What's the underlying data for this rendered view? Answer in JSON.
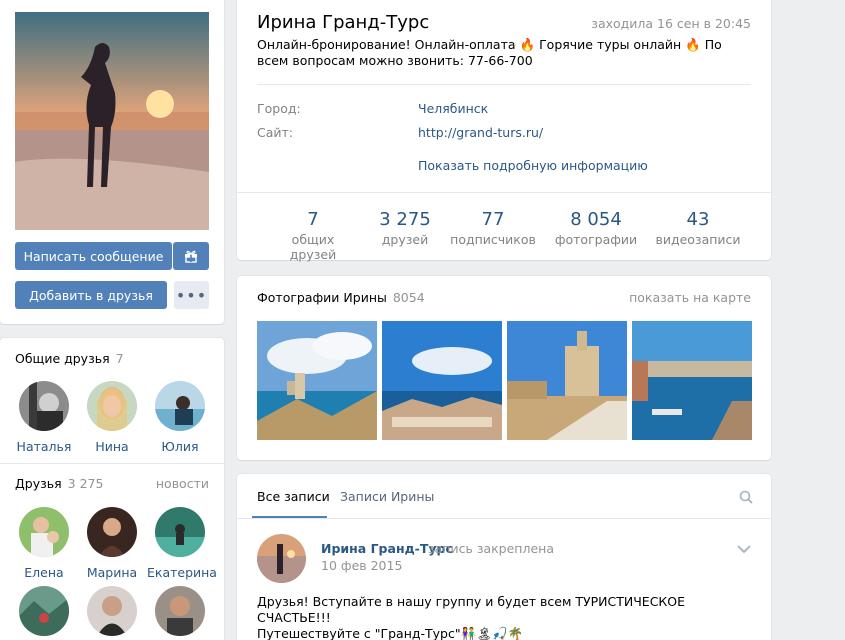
{
  "profile": {
    "name": "Ирина Гранд-Турс",
    "last_seen": "заходила 16 сен в 20:45",
    "status_parts": [
      "Онлайн-бронирование! Онлайн-оплата",
      "Горячие туры онлайн",
      "По всем вопросам можно звонить: 77-66-700"
    ],
    "fire_icon": "🔥"
  },
  "info": {
    "city_label": "Город:",
    "city_value": "Челябинск",
    "site_label": "Сайт:",
    "site_value": "http://grand-turs.ru/",
    "more_link": "Показать подробную информацию"
  },
  "counters": [
    {
      "num": "7",
      "label": "общих друзей"
    },
    {
      "num": "3 275",
      "label": "друзей"
    },
    {
      "num": "77",
      "label": "подписчиков"
    },
    {
      "num": "8 054",
      "label": "фотографии"
    },
    {
      "num": "43",
      "label": "видеозаписи"
    }
  ],
  "actions": {
    "message": "Написать сообщение",
    "add_friend": "Добавить в друзья",
    "more": "•••"
  },
  "mutual": {
    "title": "Общие друзья",
    "count": "7",
    "people": [
      "Наталья",
      "Нина",
      "Юлия"
    ]
  },
  "friends": {
    "title": "Друзья",
    "count": "3 275",
    "news": "новости",
    "people": [
      "Елена",
      "Марина",
      "Екатерина"
    ]
  },
  "photos": {
    "title": "Фотографии Ирины",
    "count": "8054",
    "map_link": "показать на карте"
  },
  "wall": {
    "tab_all": "Все записи",
    "tab_own": "Записи Ирины",
    "post": {
      "author": "Ирина Гранд-Турс",
      "pinned": "запись закреплена",
      "date": "10 фев 2015",
      "line1": "Друзья! Вступайте в нашу группу и будет всем ТУРИСТИЧЕСКОЕ СЧАСТЬЕ!!!",
      "line2": "Путешествуйте с \"Гранд-Турс\"👫🏝🎣🌴"
    }
  },
  "colors": {
    "accent": "#5181b8",
    "link": "#2a5885",
    "muted": "#939393",
    "background": "#edeef0"
  }
}
